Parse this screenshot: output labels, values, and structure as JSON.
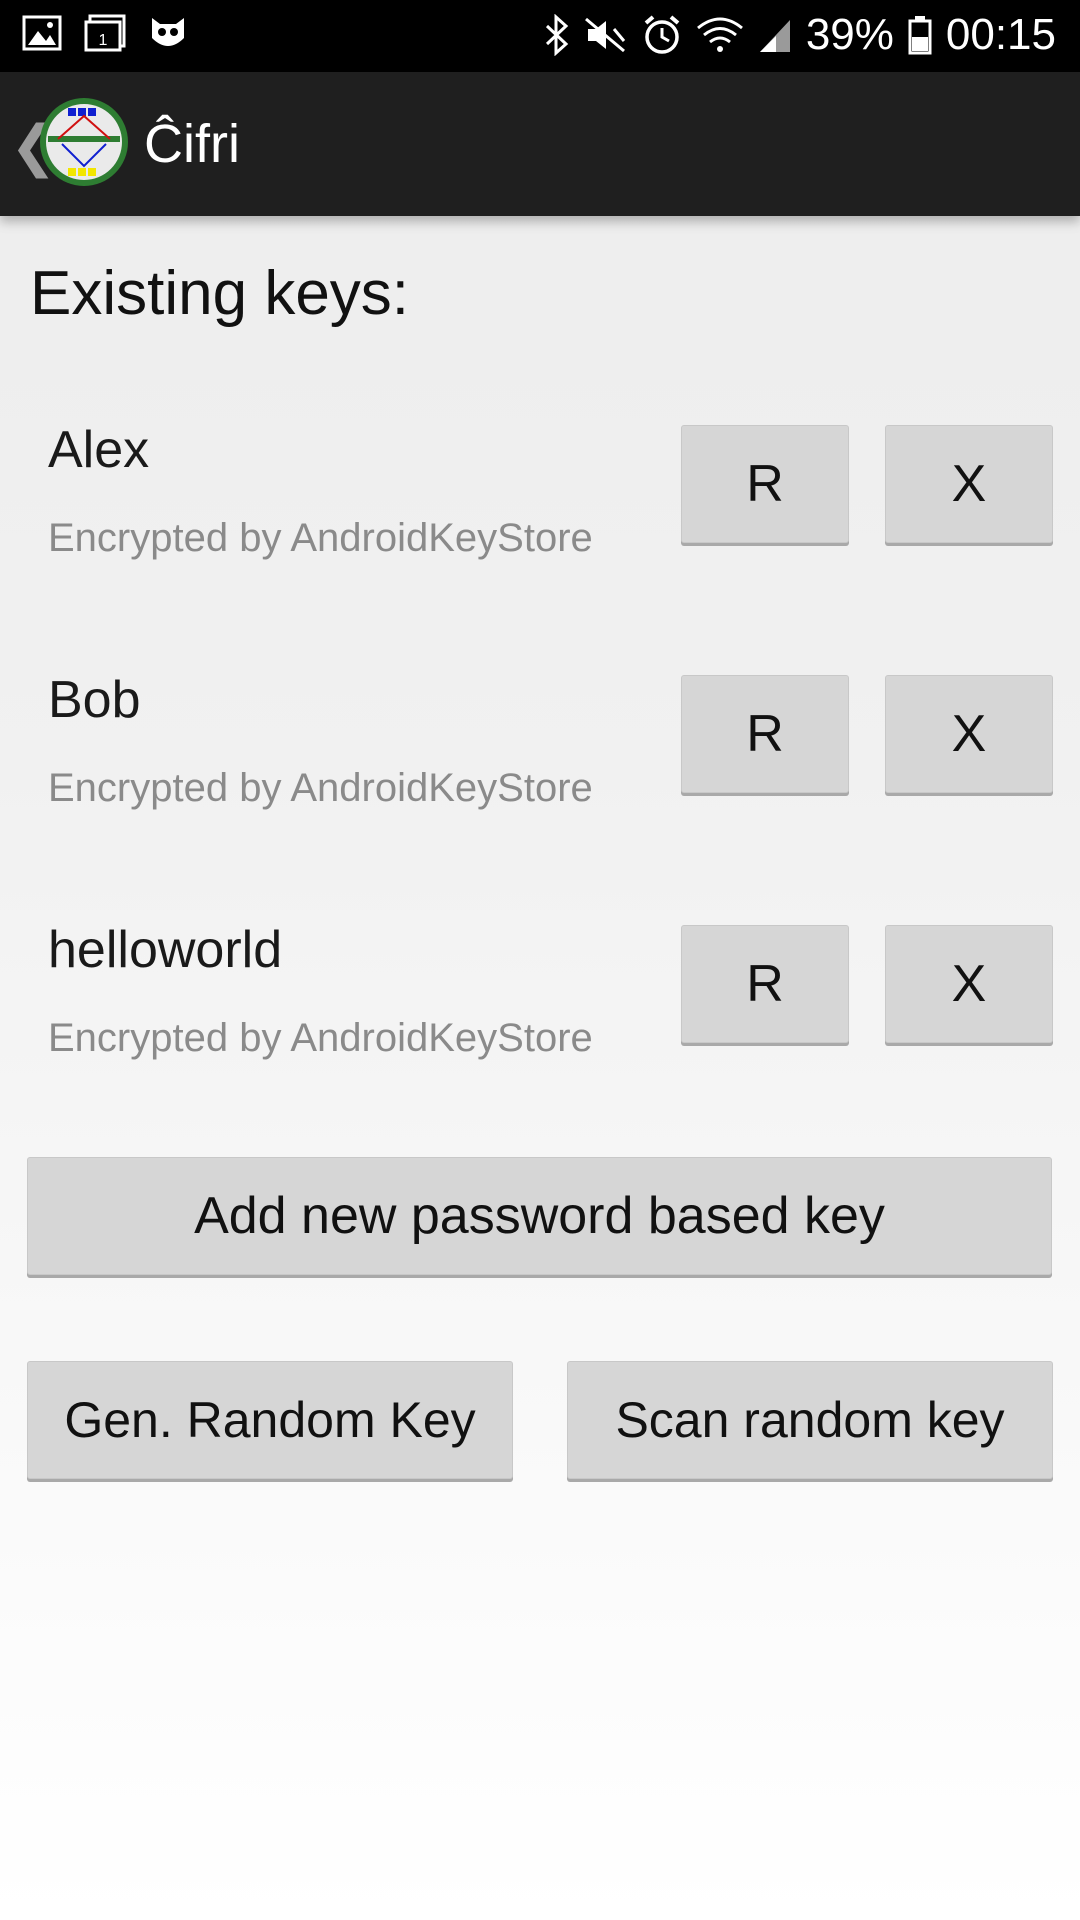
{
  "status_bar": {
    "battery_percent": "39%",
    "time": "00:15",
    "left_icons": [
      "gallery-icon",
      "calendar-icon",
      "owl-icon"
    ],
    "right_icons": [
      "bluetooth-icon",
      "mute-icon",
      "alarm-icon",
      "wifi-icon",
      "signal-icon",
      "battery-icon"
    ],
    "calendar_day": "1"
  },
  "app_bar": {
    "title": "Ĉifri",
    "back_glyph": "❮"
  },
  "main": {
    "section_title": "Existing keys:",
    "keys": [
      {
        "name": "Alex",
        "subtitle": "Encrypted by AndroidKeyStore",
        "r_label": "R",
        "x_label": "X"
      },
      {
        "name": "Bob",
        "subtitle": "Encrypted by AndroidKeyStore",
        "r_label": "R",
        "x_label": "X"
      },
      {
        "name": "helloworld",
        "subtitle": "Encrypted by AndroidKeyStore",
        "r_label": "R",
        "x_label": "X"
      }
    ],
    "add_password_key_label": "Add new password based key",
    "gen_random_key_label": "Gen. Random Key",
    "scan_random_key_label": "Scan random key"
  },
  "colors": {
    "status_bar_bg": "#000000",
    "app_bar_bg": "#1f1f1f",
    "button_bg": "#d6d6d6",
    "subtitle_text": "#8a8a8a"
  }
}
